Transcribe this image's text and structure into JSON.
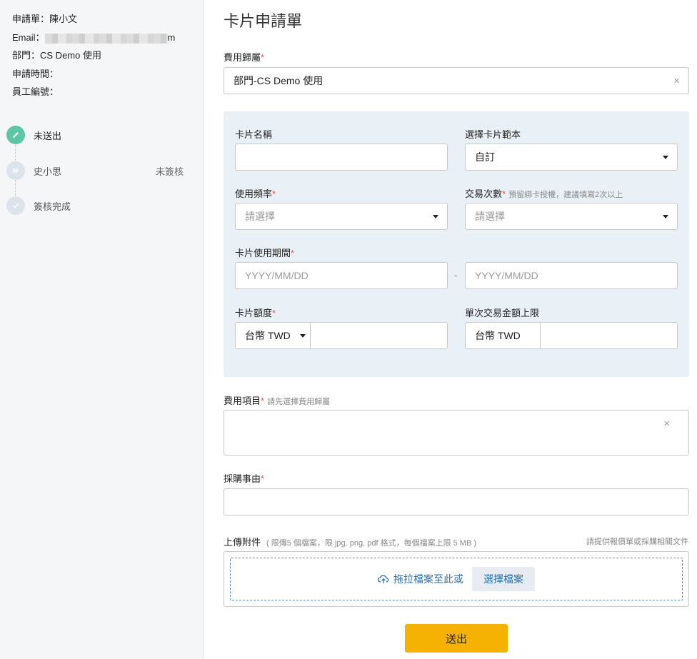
{
  "sidebar": {
    "applicant_label": "申請單：",
    "applicant_name": "陳小文",
    "email_label": "Email：",
    "email_tail": "m",
    "dept_label": "部門：",
    "dept_value": "CS Demo 使用",
    "time_label": "申請時間：",
    "emp_label": "員工編號：",
    "steps": [
      {
        "label": "未送出",
        "status": "",
        "icon": "pencil-icon",
        "color": "#5cc6a6"
      },
      {
        "label": "史小思",
        "status": "未簽核",
        "icon": "double-chevron-icon",
        "color": "#dde3ea"
      },
      {
        "label": "簽核完成",
        "status": "",
        "icon": "check-icon",
        "color": "#dde3ea"
      }
    ]
  },
  "main": {
    "title": "卡片申請單",
    "expense_owner_label": "費用歸屬",
    "expense_owner_value": "部門-CS Demo 使用",
    "card_name_label": "卡片名稱",
    "card_name_value": "",
    "template_label": "選擇卡片範本",
    "template_value": "自訂",
    "frequency_label": "使用頻率",
    "frequency_placeholder": "請選擇",
    "txn_count_label": "交易次數",
    "txn_count_hint": "預留綁卡授權，建議填寫2次以上",
    "txn_count_placeholder": "請選擇",
    "period_label": "卡片使用期間",
    "period_start_placeholder": "YYYY/MM/DD",
    "period_separator": "-",
    "period_end_placeholder": "YYYY/MM/DD",
    "limit_label": "卡片額度",
    "limit_currency": "台幣 TWD",
    "single_limit_label": "單次交易金額上限",
    "single_limit_currency": "台幣 TWD",
    "expense_item_label": "費用項目",
    "expense_item_hint": "請先選擇費用歸屬",
    "reason_label": "採購事由",
    "upload_label": "上傳附件",
    "upload_hint": "( 限傳5 個檔案，限 jpg, png, pdf 格式，每個檔案上限 5 MB )",
    "upload_right_hint": "請提供報價單或採購相關文件",
    "upload_drag_text": "拖拉檔案至此或",
    "upload_choose_button": "選擇檔案",
    "submit_button": "送出"
  },
  "colors": {
    "accent_green": "#5cc6a6",
    "panel_bg": "#e9f0f6",
    "submit_yellow": "#f5b202",
    "link_blue": "#2d6fa8",
    "required_red": "#e2564f"
  }
}
